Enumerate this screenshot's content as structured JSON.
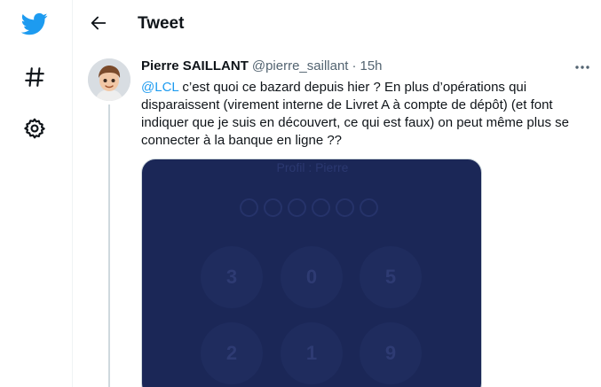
{
  "sidebar": {
    "items": [
      {
        "name": "twitter-logo",
        "icon": "twitter-bird-icon"
      },
      {
        "name": "explore",
        "icon": "hashtag-icon"
      },
      {
        "name": "settings",
        "icon": "gear-icon"
      }
    ]
  },
  "header": {
    "back_icon": "arrow-left-icon",
    "title": "Tweet"
  },
  "tweet": {
    "display_name": "Pierre SAILLANT",
    "handle": "@pierre_saillant",
    "separator": "·",
    "time": "15h",
    "mention": "@LCL",
    "text": " c’est quoi ce bazard depuis hier ? En plus d’opérations qui disparaissent (virement interne de Livret A à compte de dépôt) (et font indiquer que je suis en découvert, ce qui est faux) on peut même plus se connecter à la banque en ligne ??"
  },
  "media": {
    "profile_label": "Profil : Pierre",
    "pin_dots": 6,
    "keys": [
      "3",
      "0",
      "5",
      "2",
      "1",
      "9"
    ]
  },
  "colors": {
    "accent": "#1d9bf0",
    "text_primary": "#0f1419",
    "text_secondary": "#536471",
    "media_bg": "#1b2757"
  }
}
